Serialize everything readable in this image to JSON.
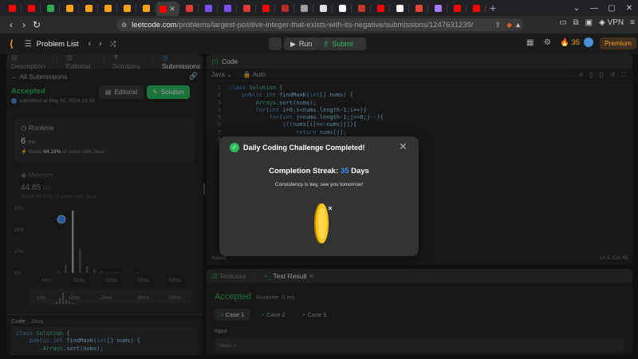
{
  "browser": {
    "tabs": [
      {
        "icon": "youtube-icon",
        "color": "#ff0000"
      },
      {
        "icon": "youtube-icon",
        "color": "#ff0000"
      },
      {
        "icon": "sheet-icon",
        "color": "#34a853"
      },
      {
        "icon": "leetcode-icon",
        "color": "#ffa116"
      },
      {
        "icon": "leetcode-icon",
        "color": "#ffa116"
      },
      {
        "icon": "leetcode-icon",
        "color": "#ffa116"
      },
      {
        "icon": "leetcode-icon",
        "color": "#ffa116"
      },
      {
        "icon": "leetcode-icon",
        "color": "#ffa116"
      },
      {
        "icon": "youtube-icon",
        "color": "#ff0000"
      },
      {
        "icon": "record-icon",
        "color": "#e53935"
      },
      {
        "icon": "leetcode-alt-icon",
        "color": "#7c4dff"
      },
      {
        "icon": "leetcode-alt-icon",
        "color": "#7c4dff"
      },
      {
        "icon": "record-icon",
        "color": "#e53935"
      },
      {
        "icon": "youtube-icon",
        "color": "#ff0000"
      },
      {
        "icon": "quora-icon",
        "color": "#b92b27"
      },
      {
        "icon": "doc-icon",
        "color": "#9e9e9e"
      },
      {
        "icon": "github-icon",
        "color": "#e0e0e0"
      },
      {
        "icon": "amazon-icon",
        "color": "#ffffff"
      },
      {
        "icon": "coursera-icon",
        "color": "#c0392b"
      },
      {
        "icon": "youtube-icon",
        "color": "#ff0000"
      },
      {
        "icon": "x-icon",
        "color": "#ffffff"
      },
      {
        "icon": "gmail-icon",
        "color": "#ea4335"
      },
      {
        "icon": "proton-icon",
        "color": "#a77bff"
      },
      {
        "icon": "youtube-icon",
        "color": "#ff0000"
      },
      {
        "icon": "youtube-icon",
        "color": "#ff0000"
      }
    ],
    "url_host": "leetcode.com",
    "url_path": "/problems/largest-positive-integer-that-exists-with-its-negative/submissions/1247631239/",
    "vpn_label": "VPN"
  },
  "leetcode_header": {
    "problem_list": "Problem List",
    "run": "Run",
    "submit": "Submit",
    "streak": "35",
    "premium": "Premium"
  },
  "left_panel": {
    "tabs": [
      "Description",
      "Editorial",
      "Solutions",
      "Submissions"
    ],
    "all_submissions": "All Submissions",
    "status": "Accepted",
    "submitted": "submitted at May 02, 2024 23:33",
    "editorial_btn": "Editorial",
    "solution_btn": "Solution",
    "runtime_label": "Runtime",
    "runtime_value": "6",
    "runtime_unit": "ms",
    "runtime_beats": "Beats",
    "runtime_pct": "64.19%",
    "runtime_suffix": "of users with Java",
    "memory_label": "Memory",
    "memory_value": "44.85",
    "memory_unit": "MB",
    "memory_beats": "Beats 43.00% of users with Java",
    "y_ticks": [
      "50%",
      "25%",
      "10%",
      "0%"
    ],
    "x_ticks": [
      "4ms",
      "11ms",
      "22ms",
      "33ms",
      "53ms"
    ],
    "mini_ticks": [
      "1ms",
      "11ms",
      "22ms",
      "36ms",
      "53ms"
    ],
    "code_tab": "Code",
    "code_lang": "Java",
    "code_lines": [
      "class Solution {",
      "    public int findMaxK(int[] nums) {",
      "        Arrays.sort(nums);"
    ]
  },
  "chart_data": {
    "type": "bar",
    "x_ticks": [
      "4ms",
      "11ms",
      "22ms",
      "33ms",
      "53ms"
    ],
    "y_ticks": [
      "50%",
      "25%",
      "10%",
      "0%"
    ],
    "highlight_value": "6ms"
  },
  "editor": {
    "title": "Code",
    "lang": "Java",
    "auto": "Auto",
    "lines": [
      "class Solution {",
      "    public int findMaxK(int[] nums) {",
      "        Arrays.sort(nums);",
      "        for(int i=0;i<nums.length-1;i++){",
      "            for(int j=nums.length-1;j>=0;j--){",
      "                if(nums[i]==-nums[j]){",
      "                    return nums[j];",
      "                }"
    ],
    "saved": "Saved",
    "cursor": "Ln 5, Col 45"
  },
  "bottom": {
    "testcase_tab": "Testcase",
    "result_tab": "Test Result",
    "status": "Accepted",
    "runtime": "Runtime: 0 ms",
    "cases": [
      "Case 1",
      "Case 2",
      "Case 3"
    ],
    "input_label": "Input",
    "input_value": "nums ="
  },
  "modal": {
    "title": "Daily Coding Challenge Completed!",
    "streak_prefix": "Completion Streak:",
    "streak_value": "35",
    "streak_suffix": "Days",
    "subtitle": "Consistency is key, see you tomorrow!"
  }
}
